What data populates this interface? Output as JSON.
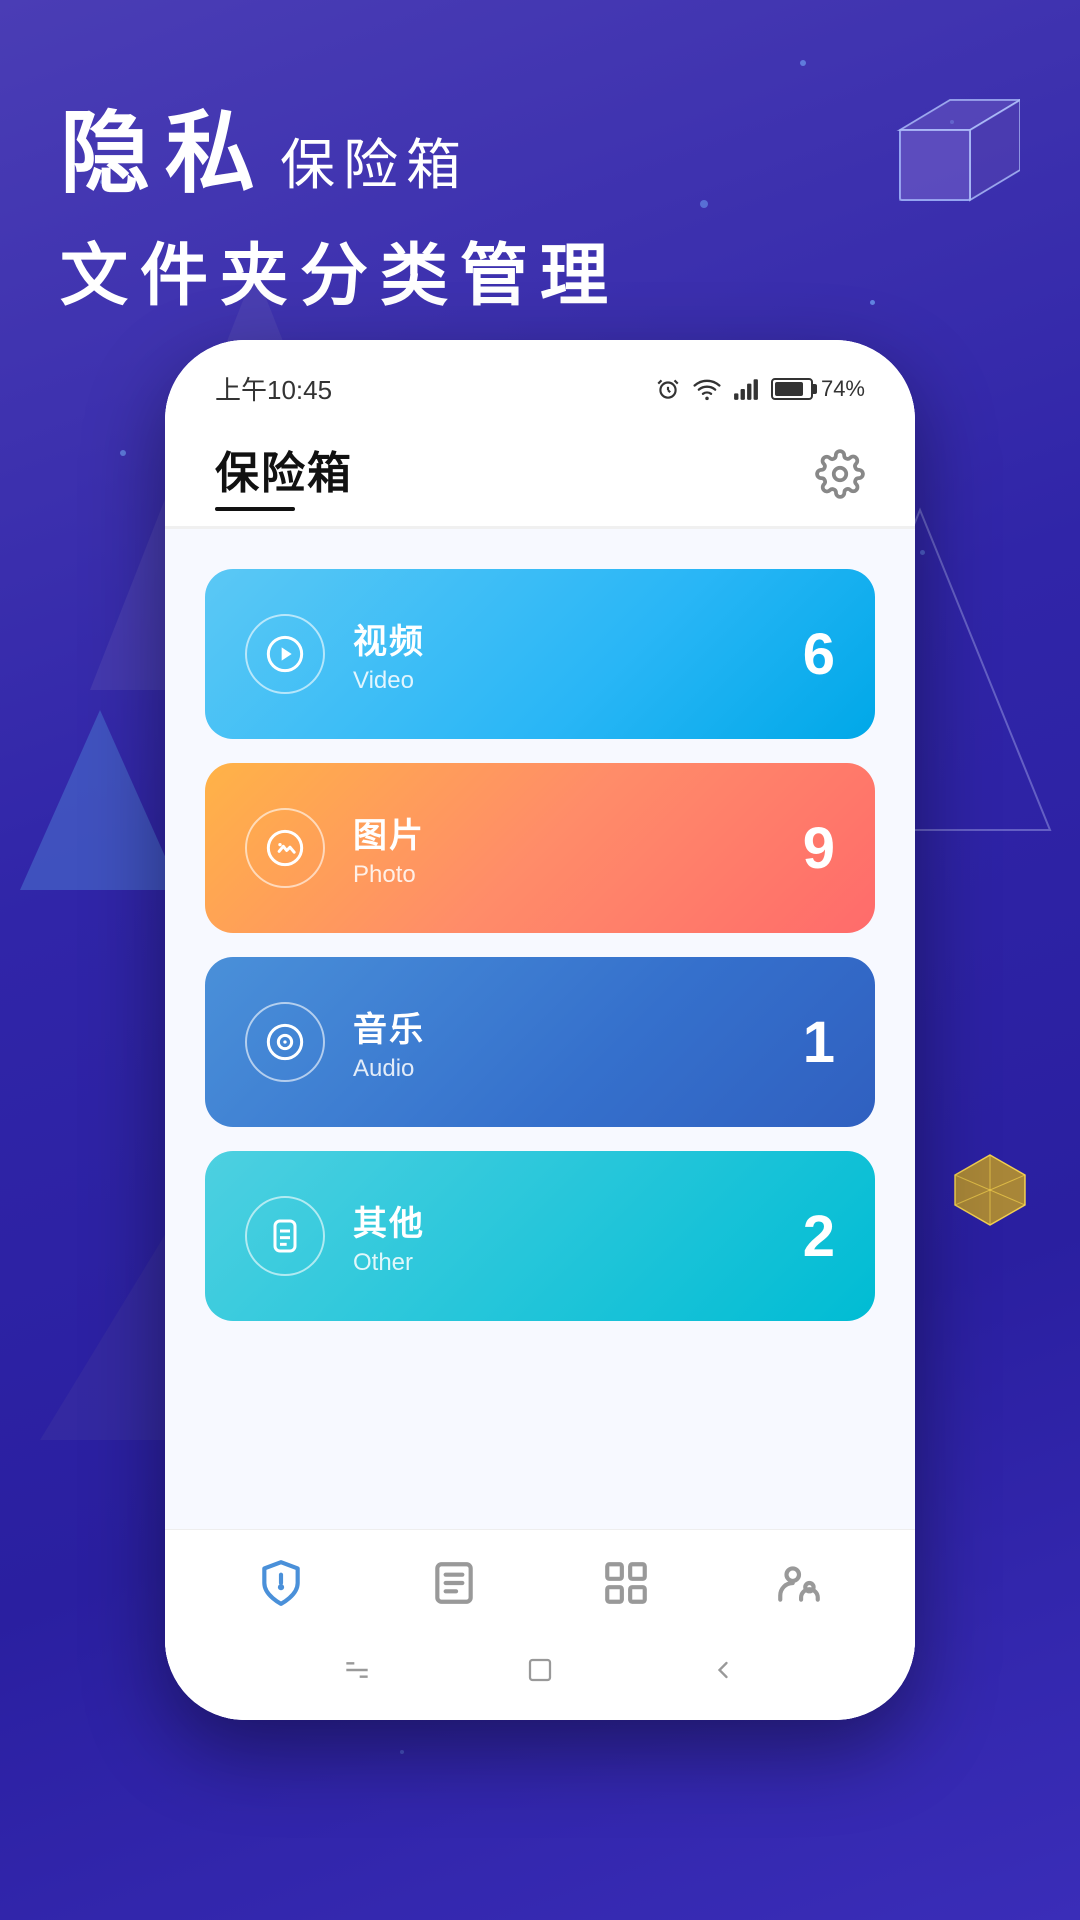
{
  "app": {
    "background_colors": [
      "#4a3db5",
      "#3025a8",
      "#2a1fa0"
    ],
    "header": {
      "line1_big": "隐私",
      "line1_small": "保险箱",
      "line2": "文件夹分类管理"
    },
    "status_bar": {
      "time": "上午10:45",
      "battery_percent": "74%"
    },
    "page_title": "保险箱",
    "categories": [
      {
        "id": "video",
        "label_cn": "视频",
        "label_en": "Video",
        "count": "6",
        "color_class": "card-video"
      },
      {
        "id": "photo",
        "label_cn": "图片",
        "label_en": "Photo",
        "count": "9",
        "color_class": "card-photo"
      },
      {
        "id": "audio",
        "label_cn": "音乐",
        "label_en": "Audio",
        "count": "1",
        "color_class": "card-audio"
      },
      {
        "id": "other",
        "label_cn": "其他",
        "label_en": "Other",
        "count": "2",
        "color_class": "card-other"
      }
    ],
    "bottom_nav": [
      {
        "id": "safe",
        "icon": "shield"
      },
      {
        "id": "notes",
        "icon": "list"
      },
      {
        "id": "apps",
        "icon": "grid"
      },
      {
        "id": "social",
        "icon": "people"
      }
    ]
  }
}
